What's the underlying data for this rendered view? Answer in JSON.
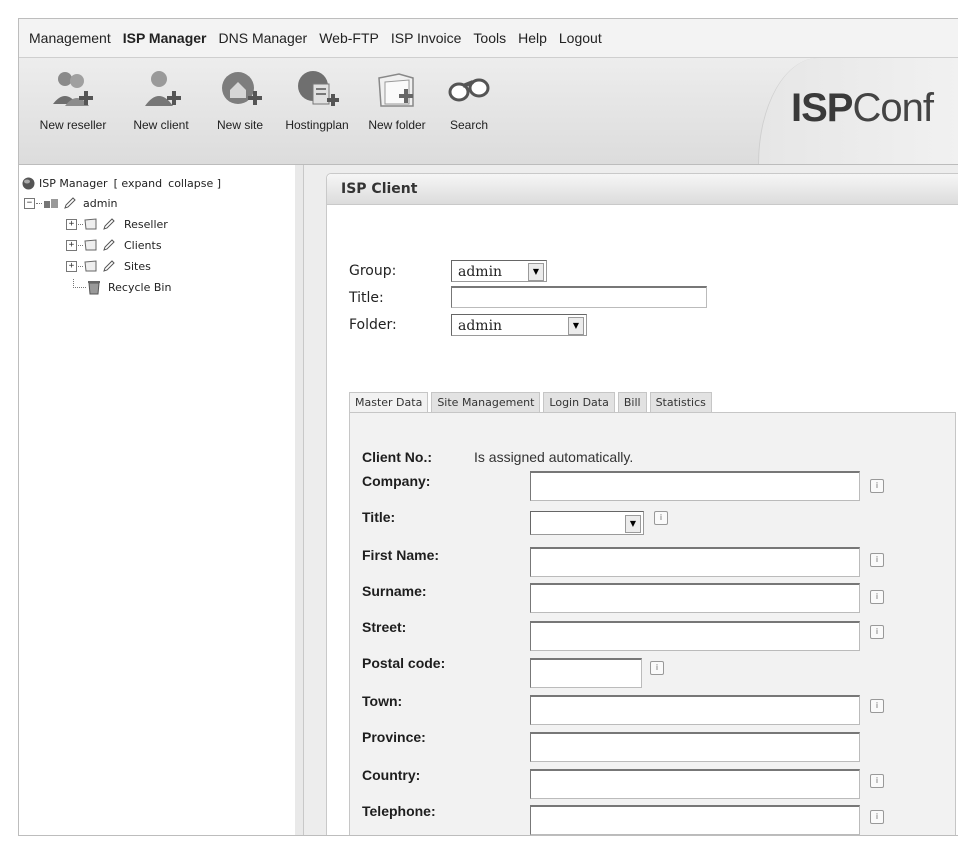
{
  "menu": {
    "items": [
      "Management",
      "ISP Manager",
      "DNS Manager",
      "Web-FTP",
      "ISP Invoice",
      "Tools",
      "Help",
      "Logout"
    ],
    "active": "ISP Manager"
  },
  "toolbar": {
    "buttons": [
      {
        "label": "New reseller",
        "icon": "reseller-icon"
      },
      {
        "label": "New client",
        "icon": "client-icon"
      },
      {
        "label": "New site",
        "icon": "site-icon"
      },
      {
        "label": "Hostingplan",
        "icon": "hostingplan-icon"
      },
      {
        "label": "New folder",
        "icon": "folder-icon"
      },
      {
        "label": "Search",
        "icon": "binoculars-icon"
      }
    ],
    "logo_bold": "ISP",
    "logo_rest": "Conf"
  },
  "tree": {
    "root_label": "ISP Manager",
    "expand": "[ expand",
    "collapse": "collapse ]",
    "user": "admin",
    "children": [
      "Reseller",
      "Clients",
      "Sites"
    ],
    "recycle": "Recycle Bin"
  },
  "panel": {
    "title": "ISP Client",
    "group_label": "Group:",
    "group_value": "admin",
    "title_label": "Title:",
    "title_value": "",
    "folder_label": "Folder:",
    "folder_value": "admin"
  },
  "tabs": [
    "Master Data",
    "Site Management",
    "Login Data",
    "Bill",
    "Statistics"
  ],
  "active_tab": "Master Data",
  "form": {
    "client_no_label": "Client No.:",
    "client_no_value": "Is assigned automatically.",
    "fields": [
      "Company:",
      "Title:",
      "First Name:",
      "Surname:",
      "Street:",
      "Postal code:",
      "Town:",
      "Province:",
      "Country:",
      "Telephone:"
    ]
  },
  "info_glyph": "i"
}
